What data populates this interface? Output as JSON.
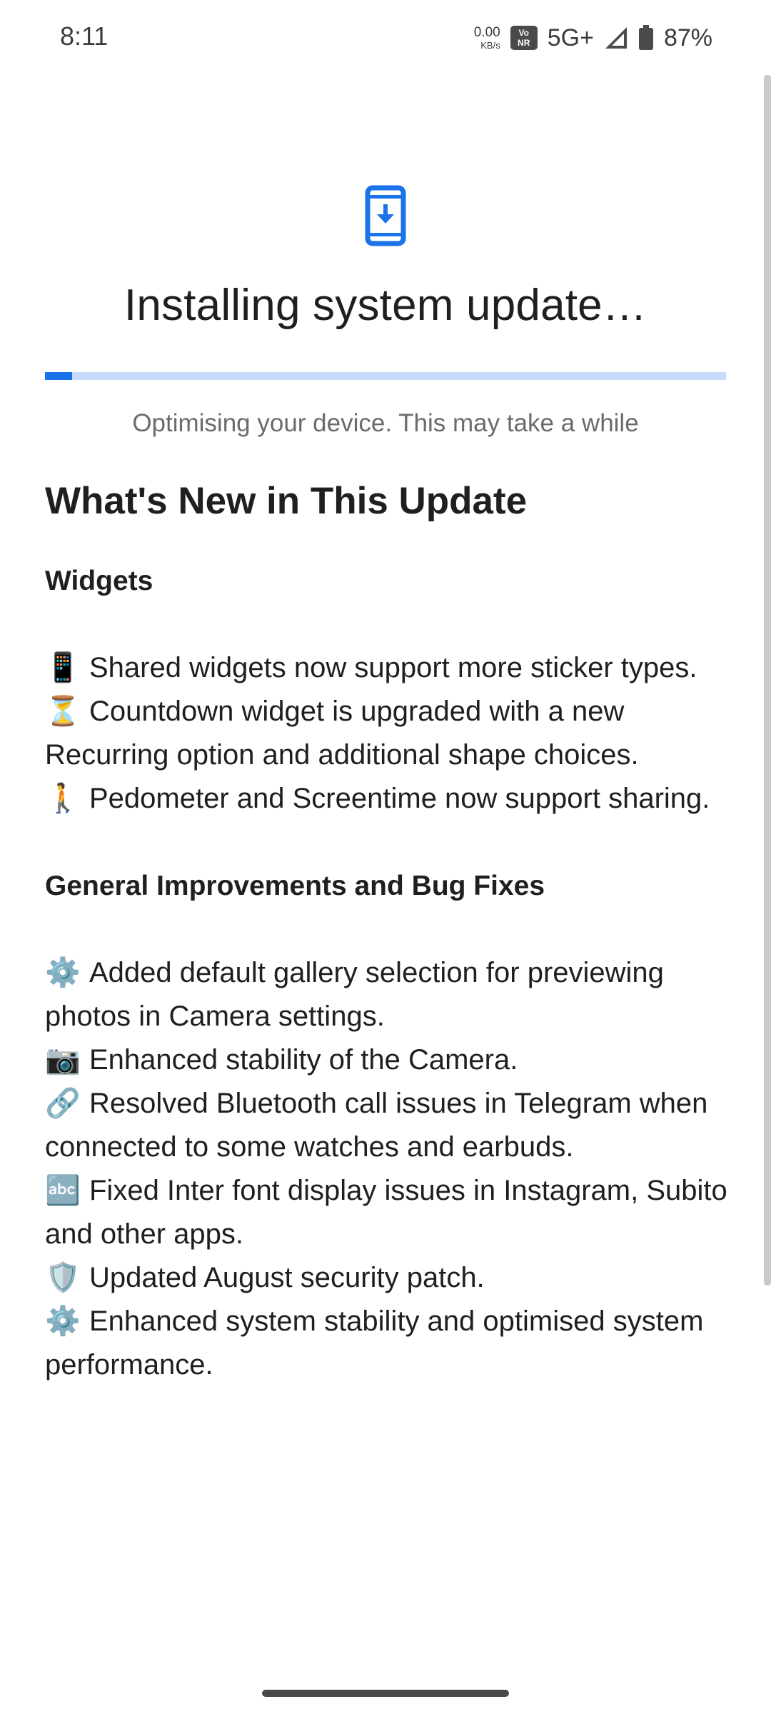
{
  "status_bar": {
    "time": "8:11",
    "net_speed_value": "0.00",
    "net_speed_unit": "KB/s",
    "vonr_top": "Vo",
    "vonr_bottom": "NR",
    "network": "5G+",
    "battery": "87%"
  },
  "header": {
    "icon": "phone-download-icon",
    "title": "Installing system update…",
    "progress_percent": 4,
    "subtitle": "Optimising your device. This may take a while"
  },
  "notes": {
    "heading": "What's New in This Update",
    "sections": [
      {
        "title": "Widgets",
        "items": [
          {
            "emoji": "📱",
            "text": "Shared widgets now support more sticker types."
          },
          {
            "emoji": "⏳",
            "text": "Countdown widget is upgraded with a new Recurring option and additional shape choices."
          },
          {
            "emoji": "🚶",
            "text": "Pedometer and Screentime now support sharing."
          }
        ]
      },
      {
        "title": "General Improvements and Bug Fixes",
        "items": [
          {
            "emoji": "⚙️",
            "text": "Added default gallery selection for previewing photos in Camera settings."
          },
          {
            "emoji": "📷",
            "text": "Enhanced stability of the Camera."
          },
          {
            "emoji": "🔗",
            "text": "Resolved Bluetooth call issues in Telegram when connected to some watches and earbuds."
          },
          {
            "emoji": "🔤",
            "text": "Fixed Inter font display issues in Instagram, Subito and other apps."
          },
          {
            "emoji": "🛡️",
            "text": "Updated August security patch."
          },
          {
            "emoji": "⚙️",
            "text": "Enhanced system stability and optimised system performance."
          }
        ]
      }
    ]
  },
  "colors": {
    "accent": "#1a73e8",
    "progress_track": "#c6dafb"
  }
}
